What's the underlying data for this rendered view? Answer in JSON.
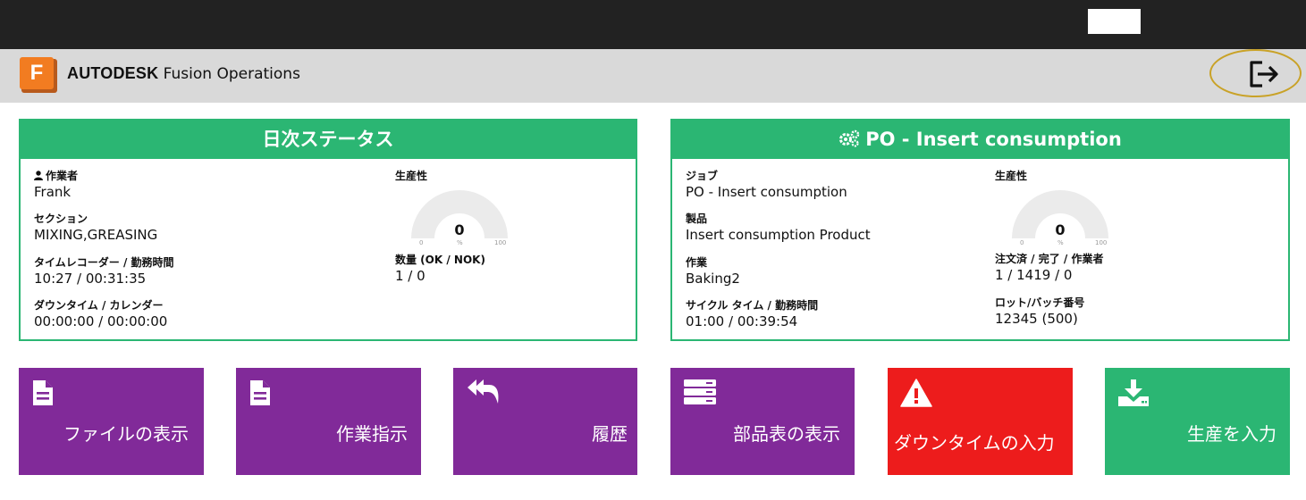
{
  "app": {
    "brand_bold": "AUTODESK",
    "brand_rest": " Fusion Operations",
    "logo_letter": "F",
    "logout_icon": "logout-icon"
  },
  "colors": {
    "green": "#2bb673",
    "purple": "#812a99",
    "red": "#ed1c1c",
    "logo_orange": "#f27c21",
    "highlight_ring": "#c9a227"
  },
  "daily_status": {
    "title": "日次ステータス",
    "operator_label": "作業者",
    "operator": "Frank",
    "section_label": "セクション",
    "section": "MIXING,GREASING",
    "time_label": "タイムレコーダー / 勤務時間",
    "time": "10:27 / 00:31:35",
    "downtime_label": "ダウンタイム / カレンダー",
    "downtime": "00:00:00 / 00:00:00",
    "productivity_label": "生産性",
    "gauge": {
      "value": "0",
      "min": "0",
      "unit": "%",
      "max": "100"
    },
    "quantity_label": "数量 (OK / NOK)",
    "quantity": "1 / 0"
  },
  "po_card": {
    "title": "PO - Insert consumption",
    "title_icon": "gears-icon",
    "job_label": "ジョブ",
    "job": "PO - Insert consumption",
    "product_label": "製品",
    "product": "Insert consumption Product",
    "operation_label": "作業",
    "operation": "Baking2",
    "cycle_label": "サイクル タイム / 勤務時間",
    "cycle": "01:00 / 00:39:54",
    "productivity_label": "生産性",
    "gauge": {
      "value": "0",
      "min": "0",
      "unit": "%",
      "max": "100"
    },
    "ordered_label": "注文済 / 完了 / 作業者",
    "ordered": "1 / 1419 / 0",
    "lot_label": "ロット/バッチ番号",
    "lot": "12345 (500)"
  },
  "tiles": [
    {
      "label": "ファイルの表示",
      "icon": "file-icon"
    },
    {
      "label": "作業指示",
      "icon": "file-icon"
    },
    {
      "label": "履歴",
      "icon": "reply-all-icon"
    },
    {
      "label": "部品表の表示",
      "icon": "server-list-icon"
    },
    {
      "label": "ダウンタイムの入力",
      "icon": "warning-icon"
    },
    {
      "label": "生産を入力",
      "icon": "download-icon"
    }
  ]
}
